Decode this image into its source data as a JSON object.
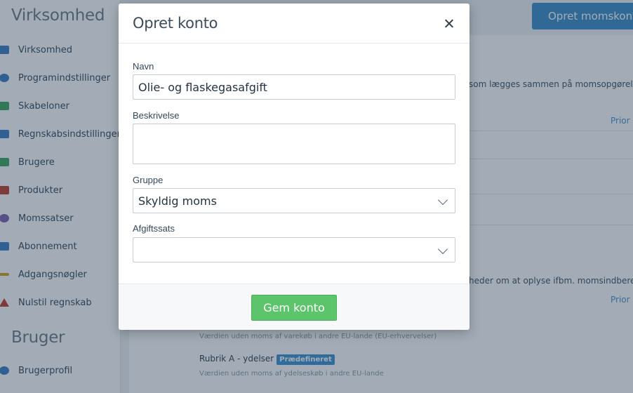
{
  "sidebar": {
    "section_company": "Virksomhed",
    "items": [
      {
        "label": "Virksomhed",
        "icon": "company-icon",
        "color": "#3a7bbf"
      },
      {
        "label": "Programindstillinger",
        "icon": "gear-icon",
        "color": "#3a7bbf"
      },
      {
        "label": "Skabeloner",
        "icon": "check-icon",
        "color": "#3aa55a"
      },
      {
        "label": "Regnskabsindstillinger",
        "icon": "ledger-icon",
        "color": "#3a7bbf"
      },
      {
        "label": "Brugere",
        "icon": "users-icon",
        "color": "#3aa55a"
      },
      {
        "label": "Produkter",
        "icon": "products-icon",
        "color": "#c0392b"
      },
      {
        "label": "Momssatser",
        "icon": "vat-icon",
        "color": "#7b5fb0"
      },
      {
        "label": "Abonnement",
        "icon": "subscription-icon",
        "color": "#3a7bbf"
      },
      {
        "label": "Adgangsnøgler",
        "icon": "key-icon",
        "color": "#d4a017"
      },
      {
        "label": "Nulstil regnskab",
        "icon": "warning-icon",
        "color": "#c0392b"
      }
    ],
    "section_user": "Bruger",
    "user_items": [
      {
        "label": "Brugerprofil",
        "icon": "profile-icon",
        "color": "#3a7bbf"
      }
    ]
  },
  "header": {
    "create_vat_account_button": "Opret momskonto"
  },
  "background": {
    "text_1": "som lægges sammen på momsopgørelse",
    "prior_1": "Prior",
    "text_2": "heder om at oplyse ifbm. momsindberet",
    "prior_2": "Prior",
    "rows": [
      {
        "title": "",
        "badge": "",
        "sub": "Værdien uden moms af varekøb i andre EU-lande (EU-erhvervelser)"
      },
      {
        "title": "Rubrik A - ydelser",
        "badge": "Prædefineret",
        "sub": "Værdien uden moms af ydelseskøb i andre EU-lande"
      }
    ]
  },
  "modal": {
    "title": "Opret konto",
    "fields": {
      "name": {
        "label": "Navn",
        "value": "Olie- og flaskegasafgift"
      },
      "description": {
        "label": "Beskrivelse",
        "value": ""
      },
      "group": {
        "label": "Gruppe",
        "value": "Skyldig moms"
      },
      "rate": {
        "label": "Afgiftssats",
        "value": ""
      }
    },
    "save_button": "Gem konto"
  },
  "colors": {
    "accent": "#3a8cc7",
    "save_green": "#5cc46a",
    "badge_blue": "#3c8fcf"
  }
}
